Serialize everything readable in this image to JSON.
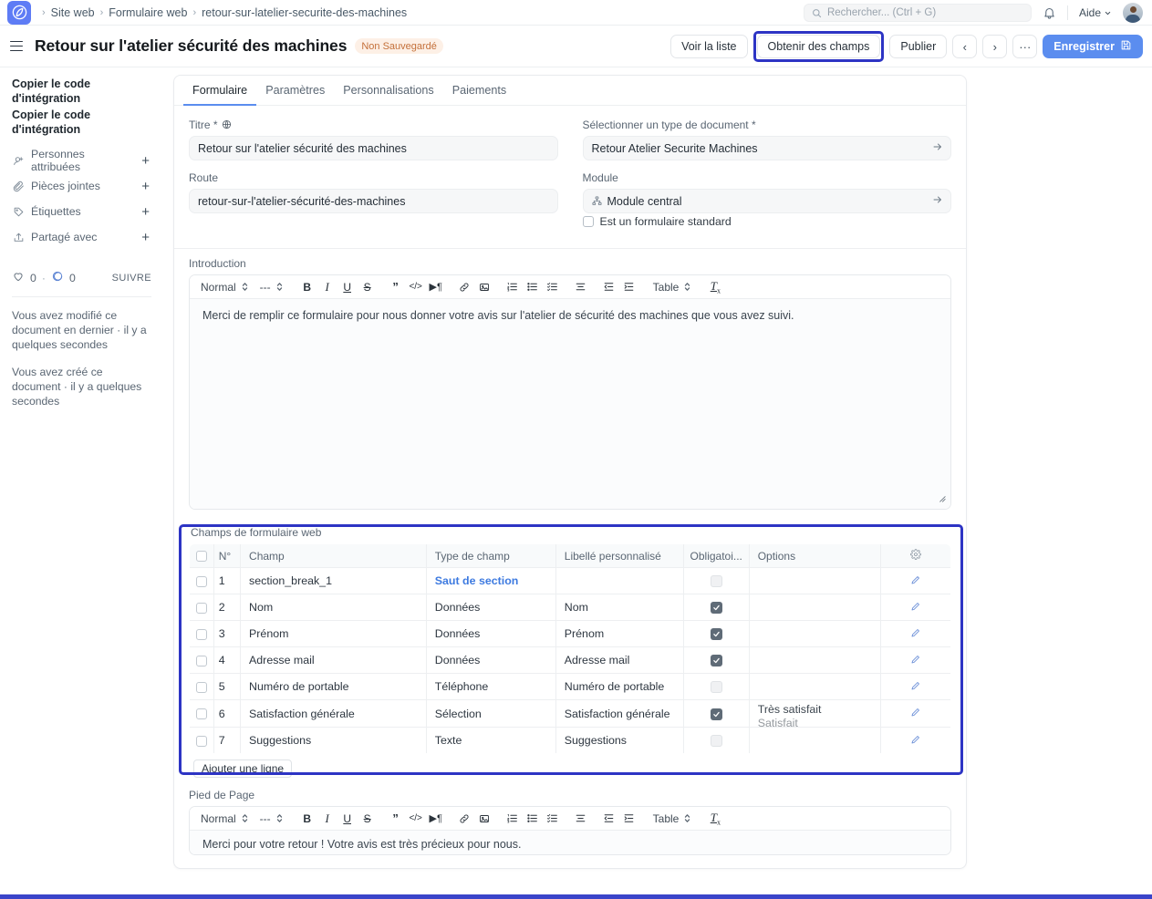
{
  "navbar": {
    "breadcrumb": [
      "Site web",
      "Formulaire web",
      "retour-sur-latelier-securite-des-machines"
    ],
    "search_placeholder": "Rechercher... (Ctrl + G)",
    "help_label": "Aide",
    "icons": {
      "search": "search-icon",
      "bell": "notification-bell-icon",
      "chevron": "chevron-down-icon",
      "avatar": "user-avatar"
    }
  },
  "page_header": {
    "title": "Retour sur l'atelier sécurité des machines",
    "status_badge": "Non Sauvegardé",
    "actions": {
      "view_list": "Voir la liste",
      "get_fields": "Obtenir des champs",
      "publish": "Publier",
      "prev": "‹",
      "next": "›",
      "more": "···",
      "save": "Enregistrer"
    }
  },
  "sidebar": {
    "links": [
      "Copier le code d'intégration",
      "Copier le code d'intégration"
    ],
    "rows": [
      {
        "icon": "assigned-people-icon",
        "label": "Personnes attribuées",
        "action": "+"
      },
      {
        "icon": "paperclip-icon",
        "label": "Pièces jointes",
        "action": "+"
      },
      {
        "icon": "tag-icon",
        "label": "Étiquettes",
        "action": "+"
      },
      {
        "icon": "share-icon",
        "label": "Partagé avec",
        "action": "+"
      }
    ],
    "stats": {
      "likes": "0",
      "separator": "·",
      "comments": "0",
      "follow": "SUIVRE"
    },
    "notes": [
      "Vous avez modifié ce document en dernier · il y a quelques secondes",
      "Vous avez créé ce document · il y a quelques secondes"
    ]
  },
  "tabs": [
    {
      "label": "Formulaire",
      "active": true
    },
    {
      "label": "Paramètres",
      "active": false
    },
    {
      "label": "Personnalisations",
      "active": false
    },
    {
      "label": "Paiements",
      "active": false
    }
  ],
  "form": {
    "title_label": "Titre *",
    "title_value": "Retour sur l'atelier sécurité des machines",
    "doctype_label": "Sélectionner un type de document *",
    "doctype_value": "Retour Atelier Securite Machines",
    "route_label": "Route",
    "route_value": "retour-sur-l'atelier-sécurité-des-machines",
    "module_label": "Module",
    "module_value": "Module central",
    "standard_checkbox_label": "Est un formulaire standard"
  },
  "introduction": {
    "label": "Introduction",
    "content": "Merci de remplir ce formulaire pour nous donner votre avis sur l'atelier de sécurité des machines que vous avez suivi."
  },
  "footer_editor": {
    "label": "Pied de Page",
    "content": "Merci pour votre retour ! Votre avis est très précieux pour nous."
  },
  "editor_toolbar": {
    "style_select": "Normal",
    "font_select": "---",
    "table_select": "Table",
    "buttons": [
      "bold-icon",
      "italic-icon",
      "underline-icon",
      "strikethrough-icon",
      "blockquote-icon",
      "code-icon",
      "paragraph-direction-icon",
      "link-icon",
      "image-icon",
      "ordered-list-icon",
      "bullet-list-icon",
      "checklist-icon",
      "align-icon",
      "outdent-icon",
      "indent-icon",
      "clear-format-icon"
    ]
  },
  "fields_table": {
    "section_label": "Champs de formulaire web",
    "columns": [
      "",
      "N°",
      "Champ",
      "Type de champ",
      "Libellé personnalisé",
      "Obligatoi...",
      "Options",
      "gear-icon"
    ],
    "rows": [
      {
        "no": "1",
        "champ": "section_break_1",
        "type": "Saut de section",
        "type_link": true,
        "libelle": "",
        "obligatoire": false,
        "options": "",
        "options2": ""
      },
      {
        "no": "2",
        "champ": "Nom",
        "type": "Données",
        "type_link": false,
        "libelle": "Nom",
        "obligatoire": true,
        "options": "",
        "options2": ""
      },
      {
        "no": "3",
        "champ": "Prénom",
        "type": "Données",
        "type_link": false,
        "libelle": "Prénom",
        "obligatoire": true,
        "options": "",
        "options2": ""
      },
      {
        "no": "4",
        "champ": "Adresse mail",
        "type": "Données",
        "type_link": false,
        "libelle": "Adresse mail",
        "obligatoire": true,
        "options": "",
        "options2": ""
      },
      {
        "no": "5",
        "champ": "Numéro de portable",
        "type": "Téléphone",
        "type_link": false,
        "libelle": "Numéro de portable",
        "obligatoire": false,
        "options": "",
        "options2": ""
      },
      {
        "no": "6",
        "champ": "Satisfaction générale",
        "type": "Sélection",
        "type_link": false,
        "libelle": "Satisfaction générale",
        "obligatoire": true,
        "options": "Très satisfait",
        "options2": "Satisfait"
      },
      {
        "no": "7",
        "champ": "Suggestions",
        "type": "Texte",
        "type_link": false,
        "libelle": "Suggestions",
        "obligatoire": false,
        "options": "",
        "options2": ""
      }
    ],
    "add_row_label": "Ajouter une ligne"
  },
  "colors": {
    "accent_blue": "#5b8def",
    "highlight_border": "#2d34c4",
    "badge_bg": "#fdf0e6",
    "badge_text": "#c4703a",
    "link_blue": "#3d7ae0",
    "bottom_bar": "#3a44c9"
  }
}
